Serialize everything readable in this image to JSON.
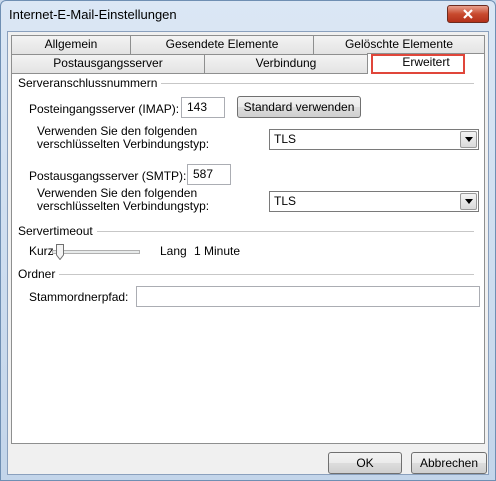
{
  "window": {
    "title": "Internet-E-Mail-Einstellungen"
  },
  "tabs_row1": [
    {
      "label": "Allgemein"
    },
    {
      "label": "Gesendete Elemente"
    },
    {
      "label": "Gelöschte Elemente"
    }
  ],
  "tabs_row2": [
    {
      "label": "Postausgangsserver"
    },
    {
      "label": "Verbindung"
    },
    {
      "label": "Erweitert",
      "active": true
    }
  ],
  "server_ports": {
    "group_title": "Serveranschlussnummern",
    "incoming_label": "Posteingangsserver (IMAP):",
    "incoming_value": "143",
    "default_button": "Standard verwenden",
    "encryption_label_1": "Verwenden Sie den folgenden verschlüsselten Verbindungstyp:",
    "encryption_value_1": "TLS",
    "outgoing_label": "Postausgangsserver (SMTP):",
    "outgoing_value": "587",
    "encryption_label_2": "Verwenden Sie den folgenden verschlüsselten Verbindungstyp:",
    "encryption_value_2": "TLS"
  },
  "timeout": {
    "group_title": "Servertimeout",
    "short_label": "Kurz",
    "long_label": "Lang",
    "value": "1 Minute",
    "slider_level": 0.05
  },
  "folders": {
    "group_title": "Ordner",
    "root_label": "Stammordnerpfad:",
    "root_value": ""
  },
  "footer": {
    "ok": "OK",
    "cancel": "Abbrechen"
  },
  "colors": {
    "highlight": "#e0463a",
    "close": "#c84a2e"
  }
}
